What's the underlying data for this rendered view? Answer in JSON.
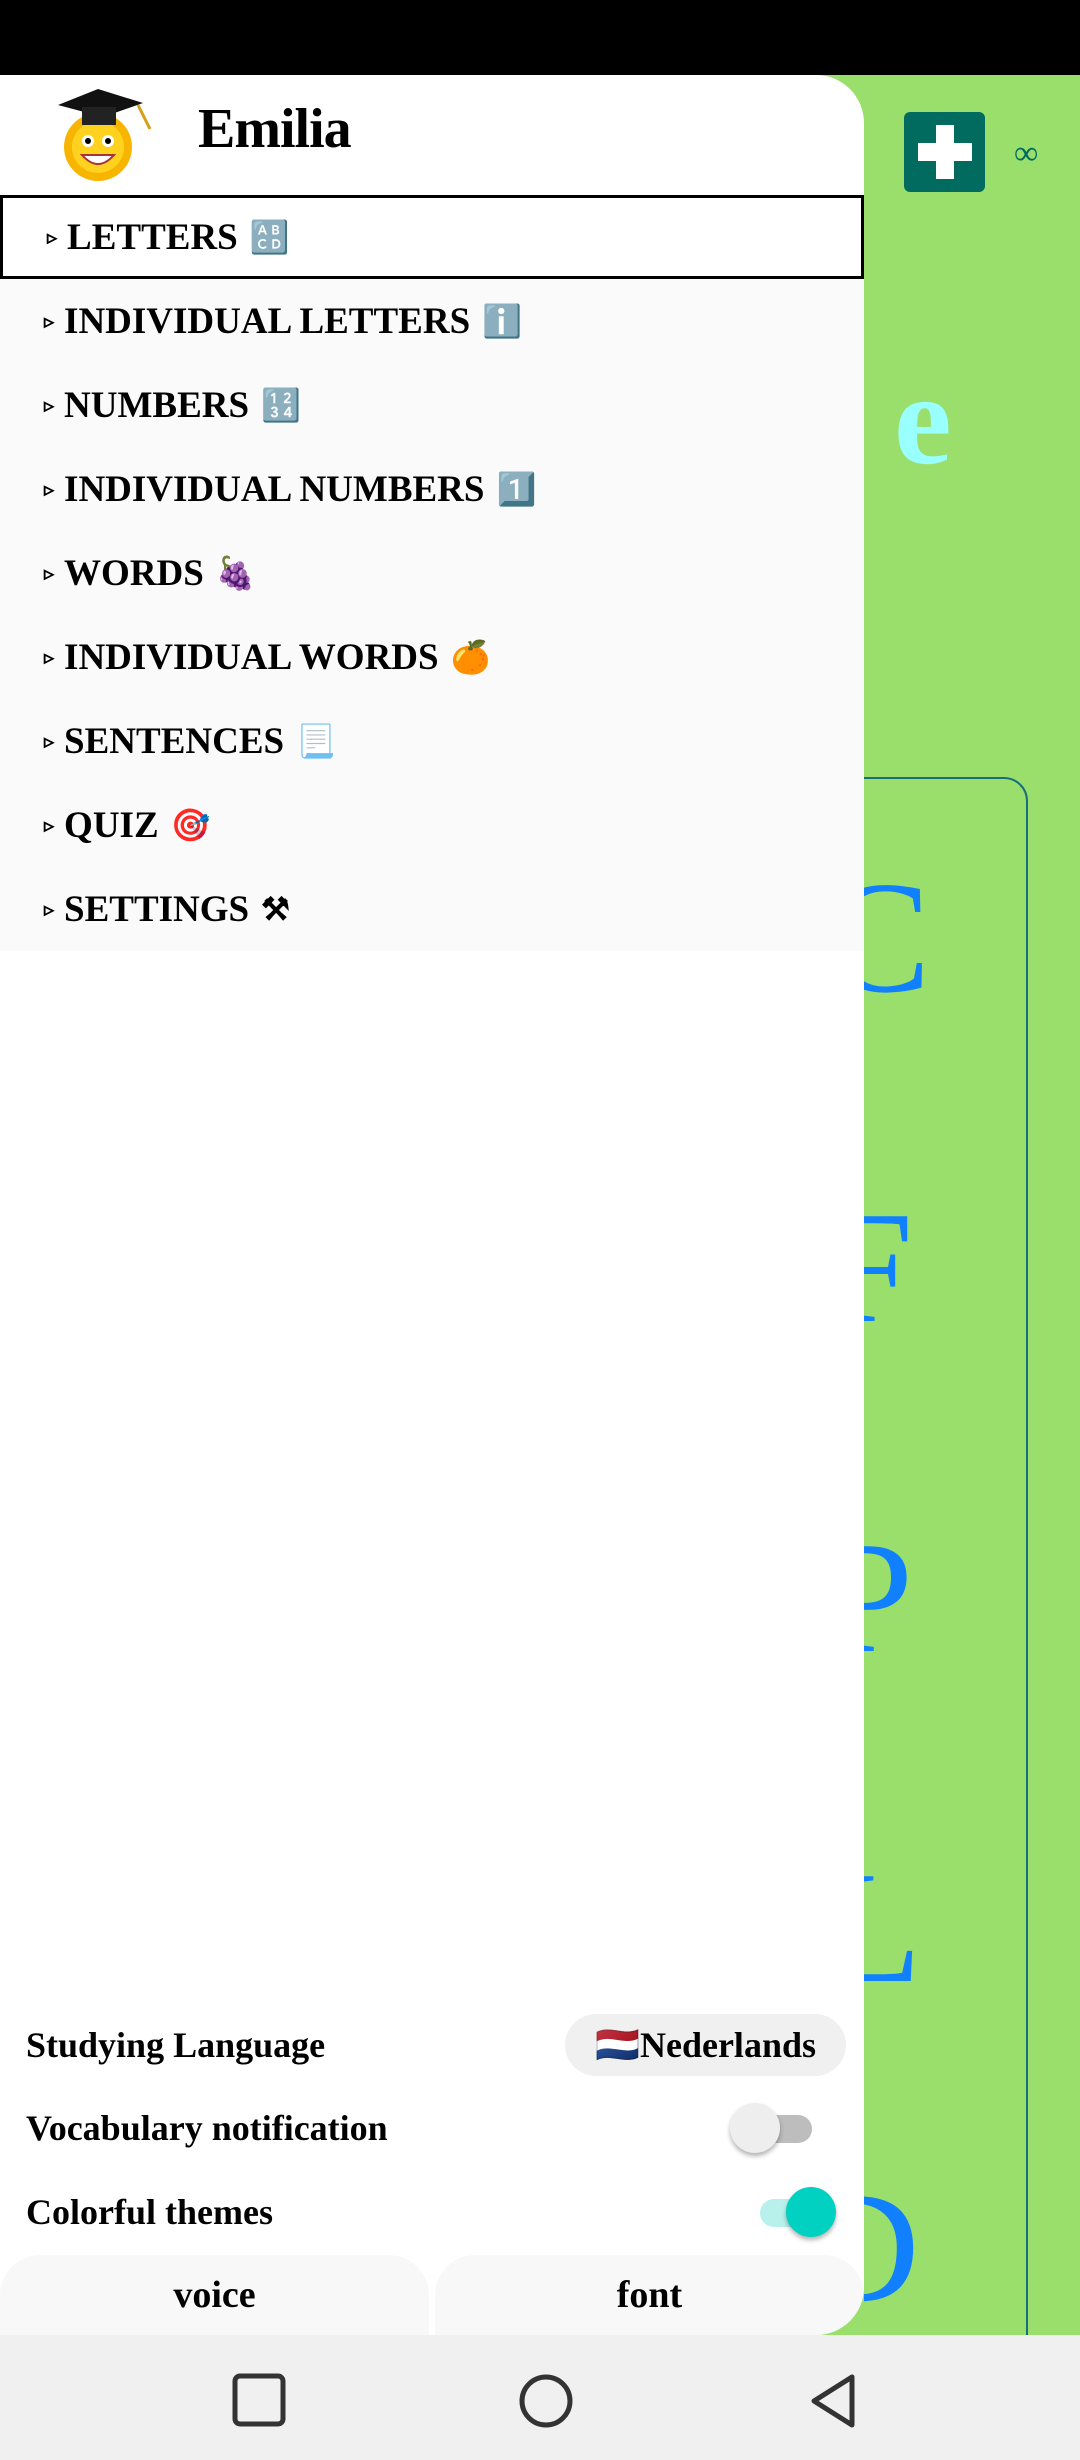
{
  "drawer": {
    "user_name": "Emilia",
    "avatar_icon": "graduate-sun-icon",
    "menu": [
      {
        "label": "LETTERS",
        "emoji": "🔠",
        "selected": true
      },
      {
        "label": "INDIVIDUAL LETTERS",
        "emoji": "ℹ️"
      },
      {
        "label": "NUMBERS",
        "emoji": "🔢"
      },
      {
        "label": "INDIVIDUAL NUMBERS",
        "emoji": "1️⃣"
      },
      {
        "label": "WORDS",
        "emoji": "🍇"
      },
      {
        "label": "INDIVIDUAL WORDS",
        "emoji": "🍊"
      },
      {
        "label": "SENTENCES",
        "emoji": "📃"
      },
      {
        "label": "QUIZ",
        "emoji": "🎯"
      },
      {
        "label": "SETTINGS",
        "emoji": "⚒"
      }
    ],
    "bullet": "▹",
    "settings": {
      "studying_language_label": "Studying Language",
      "studying_language_value": "🇳🇱Nederlands",
      "vocab_notification_label": "Vocabulary notification",
      "vocab_notification_on": false,
      "colorful_themes_label": "Colorful themes",
      "colorful_themes_on": true
    },
    "buttons": {
      "voice": "voice",
      "font": "font"
    }
  },
  "background": {
    "infinity": "∞",
    "letter_e": "e",
    "letters": [
      "C",
      "F",
      "P",
      "L",
      "D"
    ]
  },
  "colors": {
    "background": "#9ADF6B",
    "plus_button": "#006B5E",
    "accent_toggle": "#00D1C1",
    "letters": "#1080FF"
  }
}
